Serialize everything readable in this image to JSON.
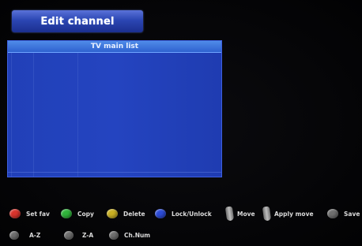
{
  "header": {
    "title": "Edit channel"
  },
  "list": {
    "title": "TV main list",
    "rows": []
  },
  "legend": {
    "row1": [
      {
        "label": "Set fav",
        "icon": "red-button-icon",
        "color": "#d8332c"
      },
      {
        "label": "Copy",
        "icon": "green-button-icon",
        "color": "#2fb43a"
      },
      {
        "label": "Delete",
        "icon": "yellow-button-icon",
        "color": "#c9b023"
      },
      {
        "label": "Lock/Unlock",
        "icon": "blue-button-icon",
        "color": "#2c4bd6"
      },
      {
        "label": "Move",
        "icon": "remote-key-icon"
      },
      {
        "label": "Apply move",
        "icon": "remote-key-icon"
      },
      {
        "label": "Save",
        "icon": "grey-button-icon"
      }
    ],
    "row2": [
      {
        "label": "A-Z",
        "icon": "grey-button-icon"
      },
      {
        "label": "Z-A",
        "icon": "grey-button-icon"
      },
      {
        "label": "Ch.Num",
        "icon": "grey-button-icon"
      }
    ]
  }
}
